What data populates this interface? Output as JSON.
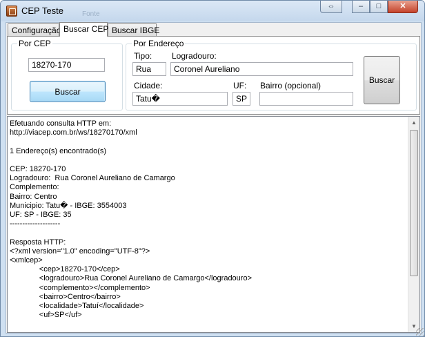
{
  "window": {
    "title": "CEP Teste",
    "background_ghost_text": "Fonte",
    "caption_buttons": {
      "left_right_arrows": "⇔",
      "minimize": "–",
      "maximize": "□",
      "close": "✕"
    }
  },
  "tabs": [
    {
      "label": "Configuração",
      "selected": false
    },
    {
      "label": "Buscar CEP",
      "selected": true
    },
    {
      "label": "Buscar IBGE",
      "selected": false
    }
  ],
  "por_cep": {
    "legend": "Por CEP",
    "cep_value": "18270-170",
    "buscar_label": "Buscar"
  },
  "por_endereco": {
    "legend": "Por Endereço",
    "tipo_label": "Tipo:",
    "tipo_value": "Rua",
    "logradouro_label": "Logradouro:",
    "logradouro_value": "Coronel Aureliano",
    "cidade_label": "Cidade:",
    "cidade_value": "Tatu�",
    "uf_label": "UF:",
    "uf_value": "SP",
    "bairro_label": "Bairro (opcional)",
    "bairro_value": "",
    "buscar_label": "Buscar"
  },
  "output": {
    "text": "Efetuando consulta HTTP em:\nhttp://viacep.com.br/ws/18270170/xml\n\n1 Endereço(s) encontrado(s)\n\nCEP: 18270-170\nLogradouro:  Rua Coronel Aureliano de Camargo\nComplemento:\nBairro: Centro\nMunicipio: Tatu� - IBGE: 3554003\nUF: SP - IBGE: 35\n--------------------\n\nResposta HTTP:\n<?xml version=\"1.0\" encoding=\"UTF-8\"?>\n<xmlcep>\n              <cep>18270-170</cep>\n              <logradouro>Rua Coronel Aureliano de Camargo</logradouro>\n              <complemento></complemento>\n              <bairro>Centro</bairro>\n              <localidade>Tatuí</localidade>\n              <uf>SP</uf>"
  },
  "scrollbar": {
    "up_arrow": "▲",
    "down_arrow": "▼"
  }
}
